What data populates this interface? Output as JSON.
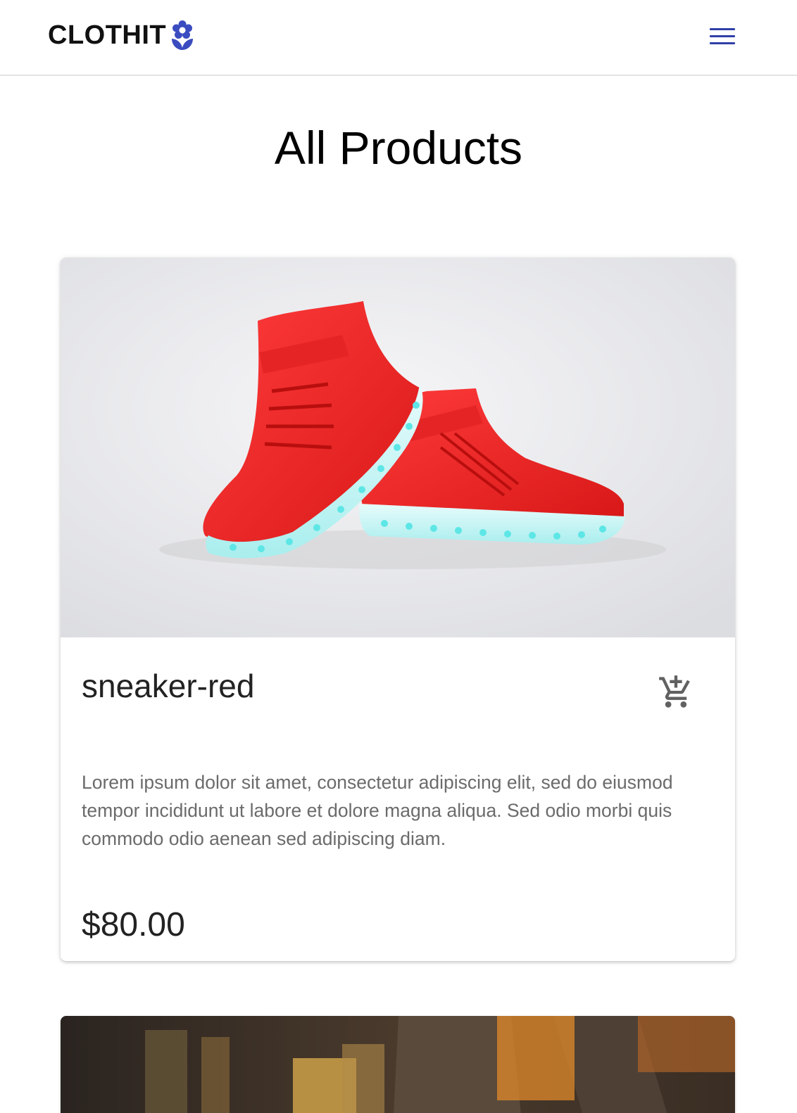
{
  "header": {
    "brand": "CLOTHIT",
    "logo_icon": "flower-icon",
    "menu_icon": "hamburger-menu-icon",
    "accent_color": "#3b4cc0"
  },
  "page": {
    "title": "All Products"
  },
  "products": [
    {
      "name": "sneaker-red",
      "image": "red-high-top-light-up-sneakers-photo",
      "cart_icon": "add-to-cart-icon",
      "description": "Lorem ipsum dolor sit amet, consectetur adipiscing elit, sed do eiusmod tempor incididunt ut labore et dolore magna aliqua. Sed odio morbi quis commodo odio aenean sed adipiscing diam.",
      "price": "$80.00"
    },
    {
      "image": "person-in-brown-pants-photo"
    }
  ]
}
